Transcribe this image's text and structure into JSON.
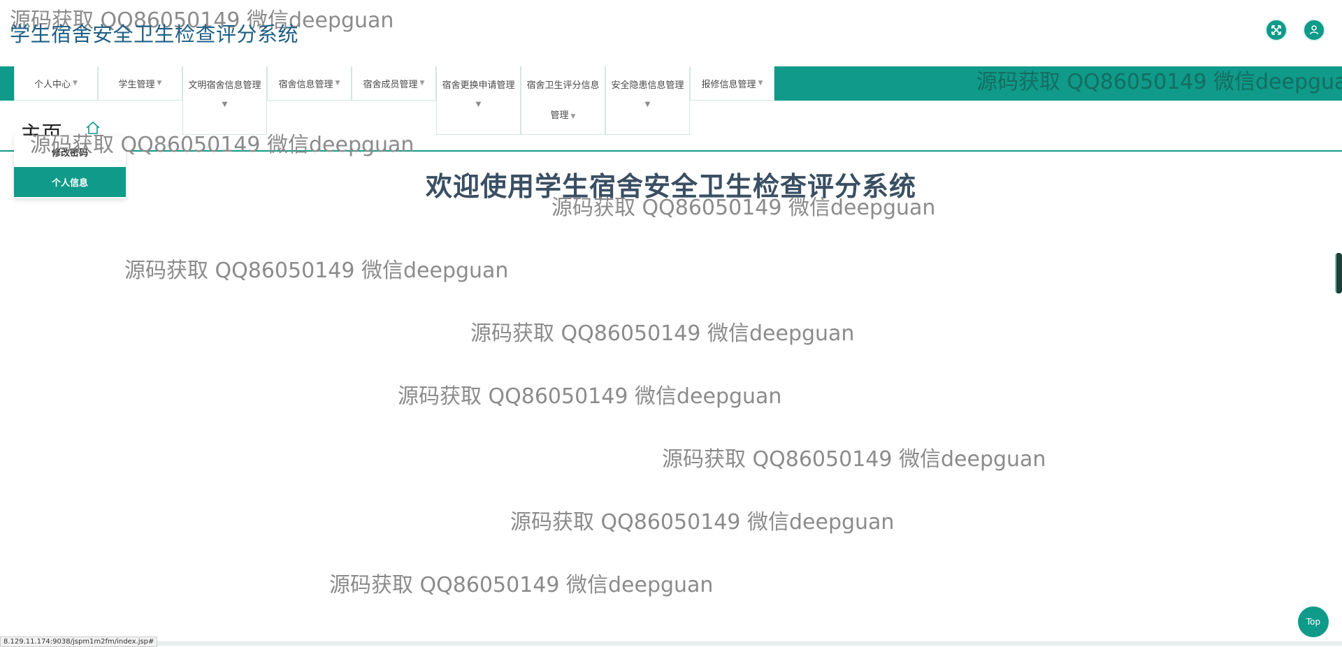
{
  "watermark_text": "源码获取 QQ86050149 微信deepguan",
  "header": {
    "title": "学生宿舍安全卫生检查评分系统",
    "fullscreen_icon": "expand-arrows-icon",
    "user_icon": "user-icon"
  },
  "nav": {
    "items": [
      {
        "label": "个人中心"
      },
      {
        "label": "学生管理"
      },
      {
        "label": "文明宿舍信息管理"
      },
      {
        "label": "宿舍信息管理"
      },
      {
        "label": "宿舍成员管理"
      },
      {
        "label": "宿舍更换申请管理"
      },
      {
        "label": "宿舍卫生评分信息",
        "label2": "管理"
      },
      {
        "label": "安全隐患信息管理"
      },
      {
        "label": "报修信息管理"
      }
    ]
  },
  "breadcrumb": {
    "title": "主页",
    "home_icon": "home-icon"
  },
  "dropdown": {
    "items": [
      {
        "label": "修改密码"
      },
      {
        "label": "个人信息"
      }
    ]
  },
  "main": {
    "welcome": "欢迎使用学生宿舍安全卫生检查评分系统"
  },
  "top_button": "Top",
  "status_url": "8.129.11.174:9038/jspm1m2fm/index.jsp#",
  "colors": {
    "accent": "#0f9a89",
    "title": "#1f5f86",
    "welcome": "#3a4f63"
  }
}
